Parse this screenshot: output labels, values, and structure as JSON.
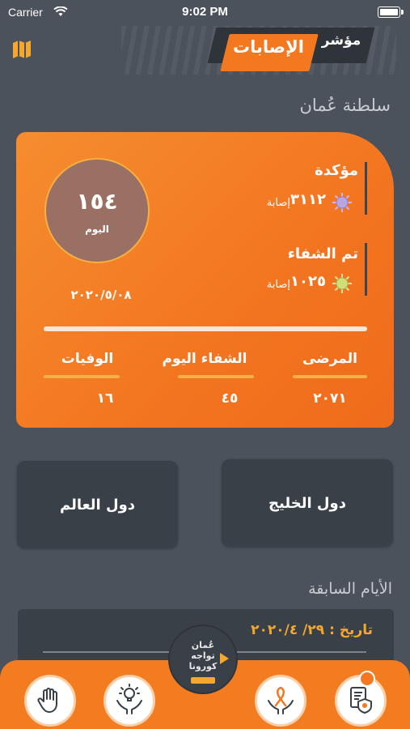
{
  "status_bar": {
    "carrier": "Carrier",
    "time": "9:02 PM"
  },
  "header": {
    "title_main": "الإصابات",
    "title_sub": "مؤشر"
  },
  "country": "سلطنة عُمان",
  "summary": {
    "days_number": "١٥٤",
    "days_label": "اليوم",
    "date": "٢٠٢٠/٥/٠٨",
    "confirmed": {
      "label": "مؤكدة",
      "value": "٣١١٢",
      "unit": "إصابة"
    },
    "recovered": {
      "label": "تم الشفاء",
      "value": "١٠٢٥",
      "unit": "إصابة"
    },
    "columns": [
      {
        "label": "المرضى",
        "value": "٢٠٧١"
      },
      {
        "label": "الشفاء اليوم",
        "value": "٤٥"
      },
      {
        "label": "الوفيات",
        "value": "١٦"
      }
    ]
  },
  "regions": {
    "gulf": "دول الخليج",
    "world": "دول العالم"
  },
  "previous": {
    "title": "الأيام السابقة",
    "date": "تاريخ :  ٢٩/ ٢٠٢٠/٤"
  },
  "colors": {
    "accent": "#f37820",
    "background": "#4b525c",
    "panel": "#3a4048",
    "highlight": "#f5a72e"
  },
  "nav_icons": [
    "hand-stop-icon",
    "idea-hands-icon",
    "ribbon-hands-icon",
    "document-shield-icon"
  ]
}
